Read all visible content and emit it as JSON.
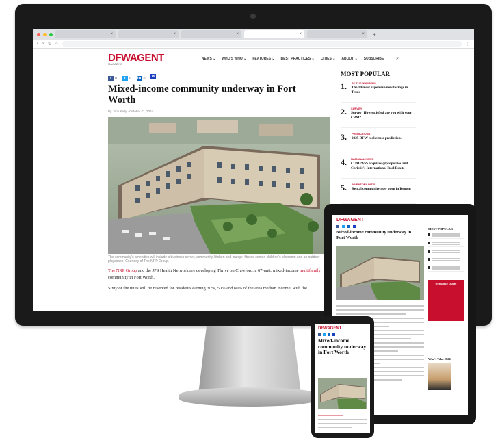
{
  "site": {
    "logo": "DFWAGENT",
    "logo_sub": "MAGAZINE",
    "brand_color": "#c8102e",
    "nav": [
      "NEWS ⌄",
      "WHO'S WHO ⌄",
      "FEATURES ⌄",
      "BEST PRACTICES ⌄",
      "CITIES ⌄",
      "ABOUT ⌄",
      "SUBSCRIBE"
    ],
    "search_icon": "search-icon"
  },
  "browser": {
    "tabs": [
      "",
      "",
      "",
      "",
      ""
    ],
    "tab_plus": "+"
  },
  "article": {
    "share": [
      {
        "icon": "facebook-icon",
        "count": "0"
      },
      {
        "icon": "twitter-icon",
        "count": "0"
      },
      {
        "icon": "linkedin-icon",
        "count": "0"
      },
      {
        "icon": "email-icon",
        "count": ""
      }
    ],
    "headline": "Mixed-income community underway in Fort Worth",
    "byline": "By John Kelly  ·  October 21, 2024",
    "caption": "The community's amenities will include a business center, community kitchen and lounge, fitness center, children's playroom and an outdoor playscape. Courtesy of The NRP Group.",
    "para1_link": "The NRP Group",
    "para1": " and the JPS Health Network are developing Thrive on Crawford, a 67-unit, mixed-income ",
    "para1_link2": "multifamily",
    "para1_end": " community in Fort Worth.",
    "para2": "Sixty of the units will be reserved for residents earning 30%, 50% and 60% of the area median income, with the"
  },
  "popular": {
    "title": "MOST POPULAR",
    "items": [
      {
        "num": "1.",
        "cat": "BY THE NUMBERS",
        "head": "The 10 most expensive new listings in Texas"
      },
      {
        "num": "2.",
        "cat": "SURVEY",
        "head": "Survey: How satisfied are you with your CRM?"
      },
      {
        "num": "3.",
        "cat": "PREDICTIONS",
        "head": "2025 DFW real estate predictions"
      },
      {
        "num": "4.",
        "cat": "NATIONAL NEWS",
        "head": "COMPASS acquires @properties and Christie's International Real Estate"
      },
      {
        "num": "5.",
        "cat": "INVENTORY INTEL",
        "head": "Rental community now open in Denton"
      }
    ]
  },
  "tablet": {
    "logo": "DFWAGENT",
    "headline": "Mixed-income community underway in Fort Worth",
    "side_title": "MOST POPULAR",
    "resource": "Resource Guide",
    "whos_who": "Who's Who 2024"
  },
  "phone": {
    "logo": "DFWAGENT",
    "headline": "Mixed-income community underway in Fort Worth"
  }
}
